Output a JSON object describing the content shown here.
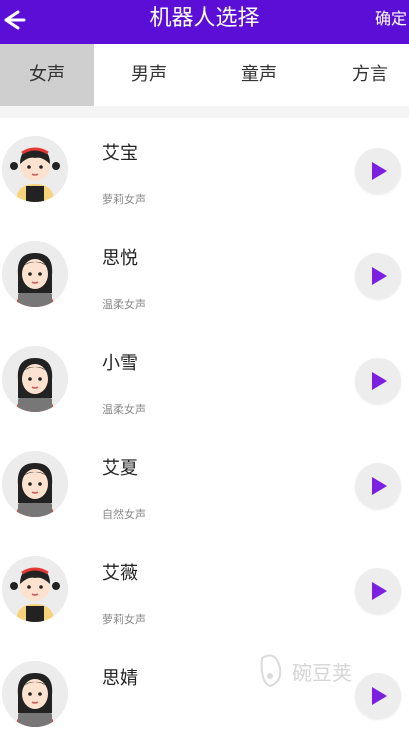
{
  "header": {
    "title": "机器人选择",
    "confirm_label": "确定"
  },
  "tabs": [
    {
      "label": "女声",
      "active": true
    },
    {
      "label": "男声",
      "active": false
    },
    {
      "label": "童声",
      "active": false
    },
    {
      "label": "方言",
      "active": false
    }
  ],
  "voices": [
    {
      "name": "艾宝",
      "desc": "萝莉女声",
      "avatar": "girl-pigtails-avatar"
    },
    {
      "name": "思悦",
      "desc": "温柔女声",
      "avatar": "girl-headset-avatar"
    },
    {
      "name": "小雪",
      "desc": "温柔女声",
      "avatar": "girl-headset-avatar"
    },
    {
      "name": "艾夏",
      "desc": "自然女声",
      "avatar": "girl-headset-avatar"
    },
    {
      "name": "艾薇",
      "desc": "萝莉女声",
      "avatar": "girl-pigtails-avatar"
    },
    {
      "name": "思婧",
      "desc": "",
      "avatar": "girl-headset-avatar"
    }
  ],
  "colors": {
    "accent": "#5b0fd6",
    "play": "#7b1fe0"
  },
  "watermark": {
    "text": "碗豆荚"
  }
}
